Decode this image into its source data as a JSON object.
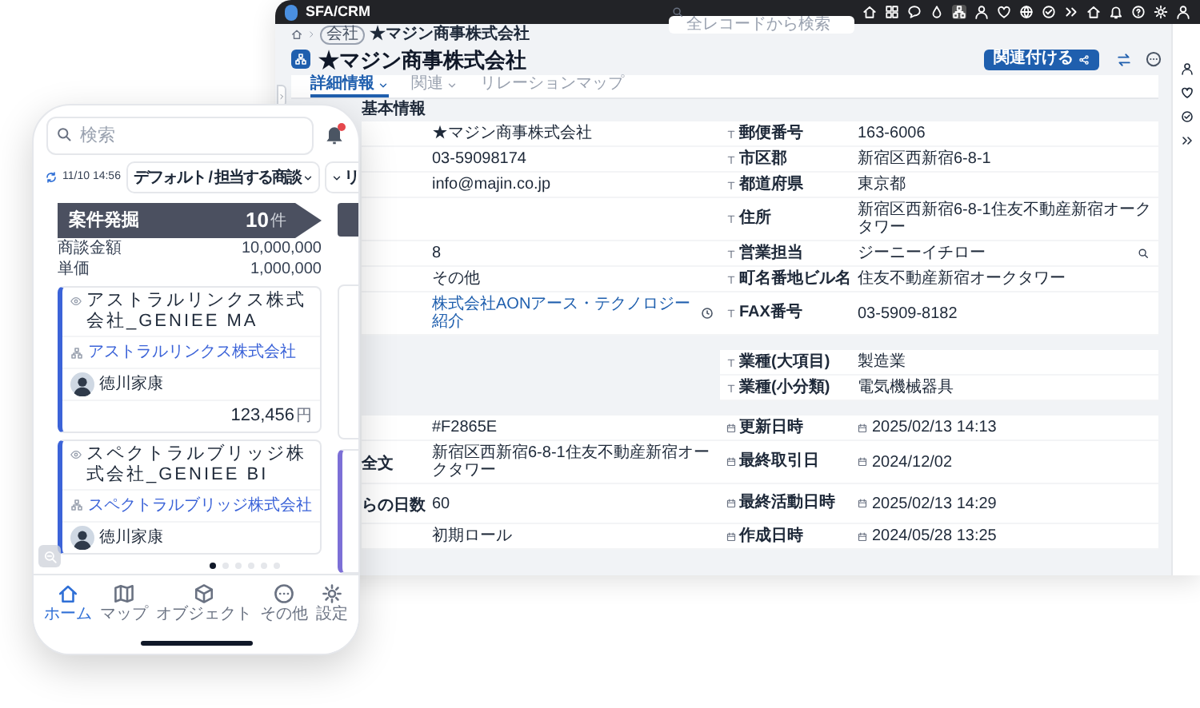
{
  "desktop": {
    "app_name": "SFA/CRM",
    "search": {
      "placeholder": "全レコードから検索"
    },
    "breadcrumb": {
      "badge": "会社",
      "current": "★マジン商事株式会社"
    },
    "record": {
      "title": "★マジン商事株式会社",
      "primary_button": "関連付ける"
    },
    "tabs": [
      {
        "label": "詳細情報",
        "selected": true,
        "dropdown": true
      },
      {
        "label": "関連",
        "selected": false,
        "dropdown": true
      },
      {
        "label": "リレーションマップ",
        "selected": false,
        "dropdown": false
      }
    ],
    "section_title": "基本情報",
    "field_groups": [
      {
        "rows": [
          {
            "left": {
              "value": "★マジン商事株式会社"
            },
            "right": {
              "label": "郵便番号",
              "value": "163-6006"
            }
          },
          {
            "left": {
              "value": "03-59098174"
            },
            "right": {
              "label": "市区郡",
              "value": "新宿区西新宿6-8-1"
            }
          },
          {
            "left": {
              "value": "info@majin.co.jp"
            },
            "right": {
              "label": "都道府県",
              "value": "東京都"
            }
          },
          {
            "left": {},
            "right": {
              "label": "住所",
              "value": "新宿区西新宿6-8-1住友不動産新宿オークタワー"
            }
          },
          {
            "left": {
              "value": "8"
            },
            "right": {
              "label": "営業担当",
              "value": "ジーニーイチロー",
              "lookup": true
            }
          },
          {
            "left": {
              "value": "その他"
            },
            "right": {
              "label": "町名番地ビル名",
              "value": "住友不動産新宿オークタワー"
            }
          },
          {
            "left": {
              "link_text": "株式会社AONアース・テクノロジー紹介"
            },
            "right": {
              "label": "FAX番号",
              "value": "03-5909-8182"
            }
          }
        ]
      },
      {
        "rows": [
          {
            "right": {
              "label": "業種(大項目)",
              "value": "製造業"
            }
          },
          {
            "right": {
              "label": "業種(小分類)",
              "value": "電気機械器具"
            }
          }
        ]
      },
      {
        "rows": [
          {
            "left": {
              "value": "#F2865E"
            },
            "right": {
              "label": "更新日時",
              "value": "2025/02/13 14:13",
              "date": true
            }
          },
          {
            "left": {
              "label": "全文",
              "value": "新宿区西新宿6-8-1住友不動産新宿オークタワー"
            },
            "right": {
              "label": "最終取引日",
              "value": "2024/12/02",
              "date": true
            }
          },
          {
            "left": {
              "label": "らの日数",
              "value": "60"
            },
            "right": {
              "label": "最終活動日時",
              "value": "2025/02/13 14:29",
              "date": true
            }
          },
          {
            "left": {
              "value": "初期ロール"
            },
            "right": {
              "label": "作成日時",
              "value": "2024/05/28 13:25",
              "date": true
            }
          }
        ]
      }
    ]
  },
  "mobile": {
    "search": {
      "placeholder": "検索"
    },
    "has_unread": true,
    "sync_time": "11/10 14:56",
    "filters": [
      {
        "label": "デフォルト / 担当する商談"
      },
      {
        "label": "リ"
      }
    ],
    "column": {
      "title": "案件発掘",
      "count": "10",
      "count_unit": "件",
      "amount_label": "商談金額",
      "amount": "10,000,000",
      "unit_price_label": "単価",
      "unit_price": "1,000,000"
    },
    "cards": [
      {
        "title": "アストラルリンクス株式会社_GENIEE MA",
        "company": "アストラルリンクス株式会社",
        "owner": "徳川家康",
        "amount": "123,456",
        "currency": "円"
      },
      {
        "title": "スペクトラルブリッジ株式会社_GENIEE BI",
        "company": "スペクトラルブリッジ株式会社",
        "owner": "徳川家康"
      }
    ],
    "page_dots": [
      {
        "selected": true
      },
      {
        "selected": false
      },
      {
        "selected": false
      },
      {
        "selected": false
      },
      {
        "selected": false
      },
      {
        "selected": false
      }
    ],
    "nav": [
      {
        "label": "ホーム",
        "selected": true
      },
      {
        "label": "マップ",
        "selected": false
      },
      {
        "label": "オブジェクト",
        "selected": false
      },
      {
        "label": "その他",
        "selected": false
      },
      {
        "label": "設定",
        "selected": false
      }
    ]
  }
}
